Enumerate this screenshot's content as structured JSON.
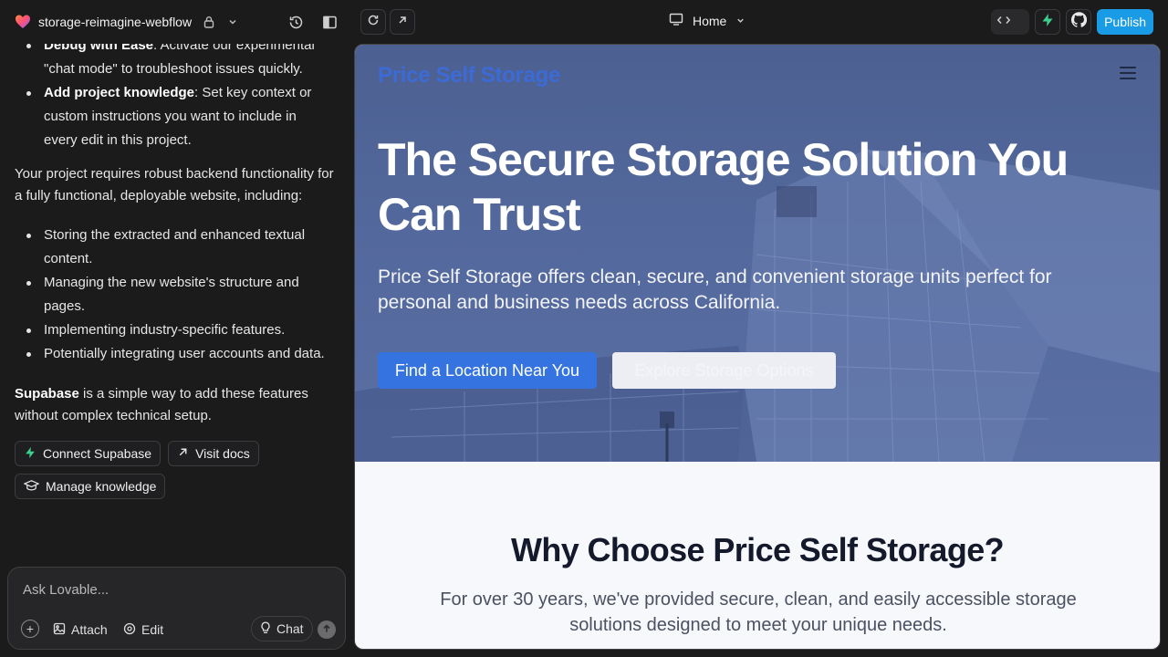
{
  "topbar": {
    "project_name": "storage-reimagine-webflow",
    "page_selector": "Home",
    "publish_label": "Publish"
  },
  "chat": {
    "intro_bullets": [
      {
        "bold": "Debug with Ease",
        "text": ": Activate our experimental \"chat mode\" to troubleshoot issues quickly."
      },
      {
        "bold": "Add project knowledge",
        "text": ": Set key context or custom instructions you want to include in every edit in this project."
      }
    ],
    "backend_para": "Your project requires robust backend functionality for a fully functional, deployable website, including:",
    "backend_bullets": [
      "Storing the extracted and enhanced textual content.",
      "Managing the new website's structure and pages.",
      "Implementing industry-specific features.",
      "Potentially integrating user accounts and data."
    ],
    "supabase_bold": "Supabase",
    "supabase_text": " is a simple way to add these features without complex technical setup.",
    "chips": {
      "connect": "Connect Supabase",
      "docs": "Visit docs",
      "knowledge": "Manage knowledge"
    },
    "input_placeholder": "Ask Lovable...",
    "attach_label": "Attach",
    "edit_label": "Edit",
    "chat_label": "Chat"
  },
  "preview": {
    "brand": "Price Self Storage",
    "hero_title": "The Secure Storage Solution You Can Trust",
    "hero_sub": "Price Self Storage offers clean, secure, and convenient storage units perfect for personal and business needs across California.",
    "cta_primary": "Find a Location Near You",
    "cta_secondary": "Explore Storage Options",
    "why_title": "Why Choose Price Self Storage?",
    "why_sub": "For over 30 years, we've provided secure, clean, and easily accessible storage solutions designed to meet your unique needs."
  },
  "colors": {
    "publish": "#1a9be6",
    "brand_blue": "#3574e0",
    "hero_overlay": "#53689c",
    "supabase_green": "#3ecf8e"
  }
}
